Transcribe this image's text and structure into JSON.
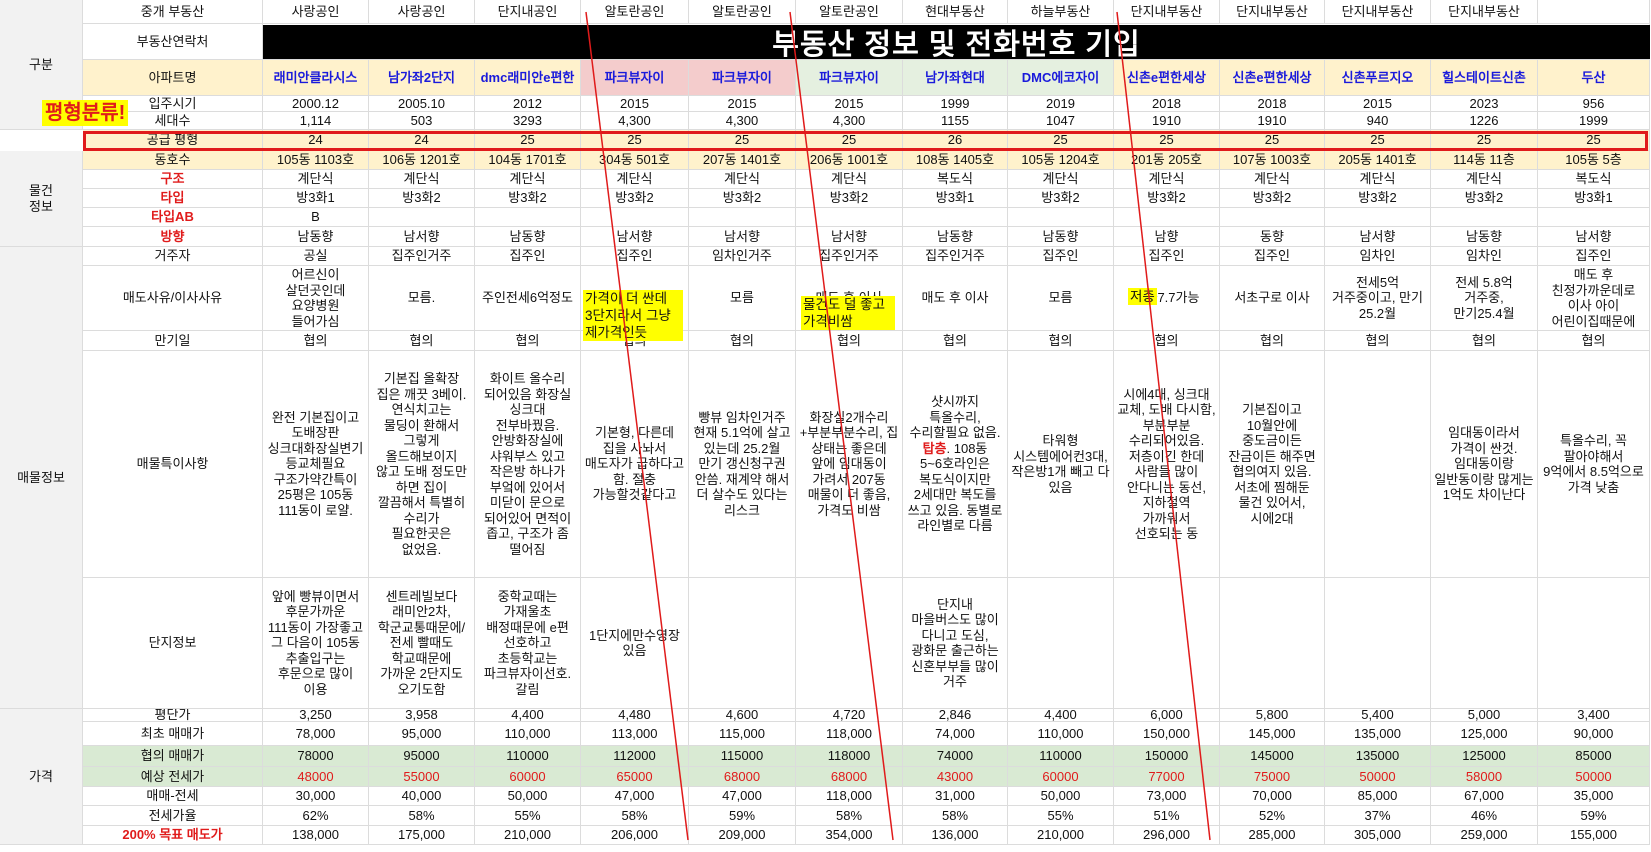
{
  "table": {
    "row_labels": {
      "realtor": "중개 부동산",
      "contact": "부동산연락처",
      "apt": "아파트명",
      "move_in": "입주시기",
      "households": "세대수",
      "area": "공급 평형",
      "dong_ho": "동호수",
      "structure": "구조",
      "type": "타입",
      "type_ab": "타입AB",
      "direction": "방향",
      "resident": "거주자",
      "reason": "매도사유/이사사유",
      "expiry": "만기일",
      "notes": "매물특이사항",
      "complex": "단지정보",
      "price_per_pyeong": "평단가",
      "first_price": "최초 매매가",
      "nego_price": "협의 매매가",
      "expected_jeonse": "예상 전세가",
      "gap": "매매-전세",
      "jeonse_ratio": "전세가율",
      "target": "200% 목표 매도가"
    },
    "sections": {
      "category": "구분",
      "property": "물건\n정보",
      "listing": "매물정보",
      "price": "가격"
    },
    "banner": "부동산 정보 및 전화번호 기입",
    "callout": "평형분류!",
    "columns": [
      {
        "realtor": "사랑공인",
        "apt": "래미안클라시스",
        "move_in": "2000.12",
        "households": "1,114",
        "area": "24",
        "dong_ho": "105동 1103호",
        "structure": "계단식",
        "type": "방3화1",
        "type_ab": "B",
        "direction": "남동향",
        "resident": "공실",
        "reason": "어르신이 살던곳인데 요양병원 들어가심",
        "expiry": "협의",
        "notes": "완전 기본집이고 도배장판 싱크대화장실변기 등교체필요 구조가약간특이 25평은 105동 111동이 로얄.",
        "complex": "앞에 빵뷰이면서 후문가까운 111동이 가장좋고 그 다음이 105동 추출입구는 후문으로 많이 이용",
        "ppp": "3,250",
        "first": "78,000",
        "nego": "78000",
        "jeonse": "48000",
        "gap": "30,000",
        "ratio": "62%",
        "target": "138,000"
      },
      {
        "realtor": "사랑공인",
        "apt": "남가좌2단지",
        "move_in": "2005.10",
        "households": "503",
        "area": "24",
        "dong_ho": "106동 1201호",
        "structure": "계단식",
        "type": "방3화2",
        "type_ab": "",
        "direction": "남서향",
        "resident": "집주인거주",
        "reason": "모름.",
        "expiry": "협의",
        "notes": "기본집 올확장 집은 깨끗 3베이. 연식치고는 물딩이 환해서 그렇게 올드해보이지 않고 도배 정도만 하면 집이 깔끔해서 특별히 수리가 필요한곳은 없었음.",
        "complex": "센트레빌보다 래미안2차, 학군교통때문에/전세 빨때도 학교때문에 가까운 2단지도 오기도함",
        "ppp": "3,958",
        "first": "95,000",
        "nego": "95000",
        "jeonse": "55000",
        "gap": "40,000",
        "ratio": "58%",
        "target": "175,000"
      },
      {
        "realtor": "단지내공인",
        "apt": "dmc래미안e편한",
        "move_in": "2012",
        "households": "3293",
        "area": "25",
        "dong_ho": "104동 1701호",
        "structure": "계단식",
        "type": "방3화2",
        "type_ab": "",
        "direction": "남동향",
        "resident": "집주인",
        "reason": "주인전세6억정도",
        "expiry": "협의",
        "notes": "화이트 올수리 되어있음 화장실 싱크대 전부바꿨음. 안방화장실에 샤워부스 있고 작은방 하나가 부엌에 있어서 미닫이 문으로 되어있어 면적이 좁고, 구조가 좀 떨어짐",
        "complex": "중학교때는 가재울초 배정때문에 e편 선호하고 초등학교는 파크뷰자이선호. 갈림",
        "ppp": "4,400",
        "first": "110,000",
        "nego": "110000",
        "jeonse": "60000",
        "gap": "50,000",
        "ratio": "55%",
        "target": "210,000"
      },
      {
        "realtor": "알토란공인",
        "apt": "파크뷰자이",
        "move_in": "2015",
        "households": "4,300",
        "area": "25",
        "dong_ho": "304동 501호",
        "structure": "계단식",
        "type": "방3화2",
        "type_ab": "",
        "direction": "남서향",
        "resident": "집주인",
        "reason": "매도 후 이사",
        "reason_hl": "가격이 더 싼데 3단지라서 그냥 제가격인듯",
        "expiry": "협의",
        "notes": "기본형, 다른데 집을 사놔서 매도자가 급하다고 함. 절충 가능할것같다고",
        "complex": "1단지에만수영장있음",
        "ppp": "4,480",
        "first": "113,000",
        "nego": "112000",
        "jeonse": "65000",
        "gap": "47,000",
        "ratio": "58%",
        "target": "206,000"
      },
      {
        "realtor": "알토란공인",
        "apt": "파크뷰자이",
        "move_in": "2015",
        "households": "4,300",
        "area": "25",
        "dong_ho": "207동 1401호",
        "structure": "계단식",
        "type": "방3화2",
        "type_ab": "",
        "direction": "남서향",
        "resident": "임차인거주",
        "reason": "모름",
        "expiry": "협의",
        "notes": "빵뷰 임차인거주 현재 5.1억에 살고 있는데 25.2월 만기 갱신청구권 안씀. 재계약 해서 더 살수도 있다는 리스크",
        "complex": "",
        "ppp": "4,600",
        "first": "115,000",
        "nego": "115000",
        "jeonse": "68000",
        "gap": "47,000",
        "ratio": "59%",
        "target": "209,000"
      },
      {
        "realtor": "알토란공인",
        "apt": "파크뷰자이",
        "move_in": "2015",
        "households": "4,300",
        "area": "25",
        "dong_ho": "206동 1001호",
        "structure": "계단식",
        "type": "방3화2",
        "type_ab": "",
        "direction": "남서향",
        "resident": "집주인거주",
        "reason": "매도 후 이사",
        "reason_hl": "물건도 덜 좋고 가격비쌈",
        "expiry": "협의",
        "notes": "화장실2개수리+부분부분수리, 집 상태는 좋은데 앞에 임대동이 가려서 207동 매물이 더 좋음, 가격도 비쌈",
        "complex": "",
        "ppp": "4,720",
        "first": "118,000",
        "nego": "118000",
        "jeonse": "68000",
        "gap": "118,000",
        "ratio": "58%",
        "target": "354,000"
      },
      {
        "realtor": "현대부동산",
        "apt": "남가좌현대",
        "move_in": "1999",
        "households": "1155",
        "area": "26",
        "dong_ho": "108동 1405호",
        "structure": "복도식",
        "type": "방3화1",
        "type_ab": "",
        "direction": "남동향",
        "resident": "집주인거주",
        "reason": "매도 후 이사",
        "expiry": "협의",
        "notes_pre": "샷시까지 특올수리, 수리할필요 없음. ",
        "notes_red": "탑층",
        "notes": ". 108동 5~6호라인은 복도식이지만 2세대만 복도를 쓰고 있음. 동별로 라인별로 다름",
        "complex": "단지내 마을버스도 많이 다니고 도심, 광화문 출근하는 신혼부부들 많이 거주",
        "ppp": "2,846",
        "first": "74,000",
        "nego": "74000",
        "jeonse": "43000",
        "gap": "31,000",
        "ratio": "58%",
        "target": "136,000"
      },
      {
        "realtor": "하늘부동산",
        "apt": "DMC에코자이",
        "move_in": "2019",
        "households": "1047",
        "area": "25",
        "dong_ho": "105동 1204호",
        "structure": "계단식",
        "type": "방3화2",
        "type_ab": "",
        "direction": "남동향",
        "resident": "집주인",
        "reason": "모름",
        "expiry": "협의",
        "notes": "타워형 시스템에어컨3대, 작은방1개 빼고 다 있음",
        "complex": "",
        "ppp": "4,400",
        "first": "110,000",
        "nego": "110000",
        "jeonse": "60000",
        "gap": "50,000",
        "ratio": "55%",
        "target": "210,000"
      },
      {
        "realtor": "단지내부동산",
        "apt": "신촌e편한세상",
        "move_in": "2018",
        "households": "1910",
        "area": "25",
        "dong_ho": "201동 205호",
        "structure": "계단식",
        "type": "방3화2",
        "type_ab": "",
        "direction": "남향",
        "resident": "집주인",
        "reason": "주차7.7가능",
        "reason_hl": "저층",
        "expiry": "협의",
        "notes": "시에4대, 싱크대 교체, 도배 다시함, 부분부분 수리되어있음. 저층이긴 한데 사람들 많이 안다니는 동선, 지하철역 가까워서 선호되는 동",
        "complex": "",
        "ppp": "6,000",
        "first": "150,000",
        "nego": "150000",
        "jeonse": "77000",
        "gap": "73,000",
        "ratio": "51%",
        "target": "296,000"
      },
      {
        "realtor": "단지내부동산",
        "apt": "신촌e편한세상",
        "move_in": "2018",
        "households": "1910",
        "area": "25",
        "dong_ho": "107동 1003호",
        "structure": "계단식",
        "type": "방3화2",
        "type_ab": "",
        "direction": "동향",
        "resident": "집주인",
        "reason": "서초구로 이사",
        "expiry": "협의",
        "notes": "기본집이고 10월안에 중도금이든 잔금이든 해주면 협의여지 있음. 서초에 찜해둔 물건 있어서, 시에2대",
        "complex": "",
        "ppp": "5,800",
        "first": "145,000",
        "nego": "145000",
        "jeonse": "75000",
        "gap": "70,000",
        "ratio": "52%",
        "target": "285,000"
      },
      {
        "realtor": "단지내부동산",
        "apt": "신촌푸르지오",
        "move_in": "2015",
        "households": "940",
        "area": "25",
        "dong_ho": "205동 1401호",
        "structure": "계단식",
        "type": "방3화2",
        "type_ab": "",
        "direction": "남서향",
        "resident": "임차인",
        "reason": "전세5억 거주중이고, 만기 25.2월",
        "expiry": "협의",
        "notes": "",
        "complex": "",
        "ppp": "5,400",
        "first": "135,000",
        "nego": "135000",
        "jeonse": "50000",
        "gap": "85,000",
        "ratio": "37%",
        "target": "305,000"
      },
      {
        "realtor": "단지내부동산",
        "apt": "힐스테이트신촌",
        "move_in": "2023",
        "households": "1226",
        "area": "25",
        "dong_ho": "114동 11층",
        "structure": "계단식",
        "type": "방3화2",
        "type_ab": "",
        "direction": "남동향",
        "resident": "임차인",
        "reason": "전세 5.8억 거주중, 만기25.4월",
        "expiry": "협의",
        "notes": "임대동이라서 가격이 싼것. 임대동이랑 일반동이랑 많게는 1억도 차이난다",
        "complex": "",
        "ppp": "5,000",
        "first": "125,000",
        "nego": "125000",
        "jeonse": "58000",
        "gap": "67,000",
        "ratio": "46%",
        "target": "259,000"
      },
      {
        "realtor": "",
        "apt": "두산",
        "move_in": "956",
        "households": "1999",
        "area": "25",
        "dong_ho": "105동 5층",
        "structure": "복도식",
        "type": "방3화1",
        "type_ab": "",
        "direction": "남서향",
        "resident": "집주인",
        "reason": "매도 후 친정가까운데로 이사 아이 어린이집때문에",
        "expiry": "협의",
        "notes": "특올수리, 꼭 팔아야해서 9억에서 8.5억으로 가격 낮춤",
        "complex": "",
        "ppp": "3,400",
        "first": "90,000",
        "nego": "85000",
        "jeonse": "50000",
        "gap": "35,000",
        "ratio": "59%",
        "target": "155,000"
      }
    ]
  },
  "colors": {
    "blue_text": "#1a1adb",
    "red_text": "#e01b1b",
    "yellow_highlight": "#ffff00",
    "header_yellow": "#fff2cc",
    "green_row": "#d9ead3",
    "pink_header": "#f4cccc",
    "banner_bg": "#000000"
  }
}
